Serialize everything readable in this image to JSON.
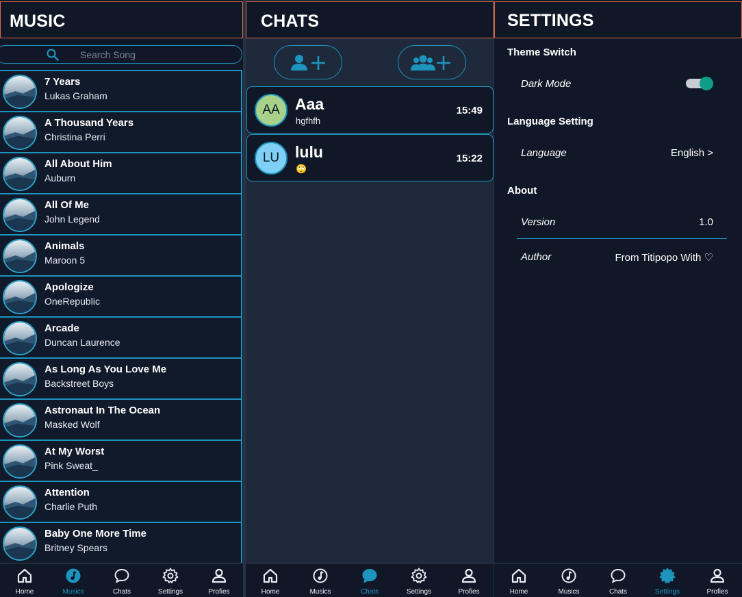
{
  "colors": {
    "accent": "#1d94bd",
    "header_border": "#d96a48",
    "toggle_on": "#0f9c88",
    "avatar_aa": "#a8d18a",
    "avatar_lu": "#7fd0f4"
  },
  "music": {
    "title": "MUSIC",
    "search_placeholder": "Search Song",
    "songs": [
      {
        "title": "7 Years",
        "artist": "Lukas Graham"
      },
      {
        "title": "A Thousand Years",
        "artist": "Christina Perri"
      },
      {
        "title": "All About Him",
        "artist": "Auburn"
      },
      {
        "title": "All Of Me",
        "artist": "John Legend"
      },
      {
        "title": "Animals",
        "artist": "Maroon 5"
      },
      {
        "title": "Apologize",
        "artist": "OneRepublic"
      },
      {
        "title": "Arcade",
        "artist": "Duncan Laurence"
      },
      {
        "title": "As Long As You Love Me",
        "artist": "Backstreet Boys"
      },
      {
        "title": "Astronaut In The Ocean",
        "artist": "Masked Wolf"
      },
      {
        "title": "At My Worst",
        "artist": "Pink Sweat_"
      },
      {
        "title": "Attention",
        "artist": "Charlie Puth"
      },
      {
        "title": "Baby One More Time",
        "artist": "Britney Spears"
      }
    ]
  },
  "chats": {
    "title": "CHATS",
    "add_user_icon": "add-person-icon",
    "add_group_icon": "add-group-icon",
    "items": [
      {
        "initials": "AA",
        "name": "Aaa",
        "message": "hgfhfh",
        "time": "15:49"
      },
      {
        "initials": "LU",
        "name": "lulu",
        "message": "🙄",
        "time": "15:22"
      }
    ]
  },
  "settings": {
    "title": "SETTINGS",
    "theme_section": "Theme Switch",
    "dark_mode_label": "Dark Mode",
    "dark_mode_on": true,
    "language_section": "Language Setting",
    "language_label": "Language",
    "language_value": "English >",
    "about_section": "About",
    "version_label": "Version",
    "version_value": "1.0",
    "author_label": "Author",
    "author_value": "From Titipopo With ♡"
  },
  "nav": {
    "items": [
      {
        "label": "Home",
        "icon": "home-icon"
      },
      {
        "label": "Musics",
        "icon": "music-icon"
      },
      {
        "label": "Chats",
        "icon": "chat-bubble-icon"
      },
      {
        "label": "Settings",
        "icon": "gear-icon"
      },
      {
        "label": "Profies",
        "icon": "person-icon"
      }
    ]
  }
}
